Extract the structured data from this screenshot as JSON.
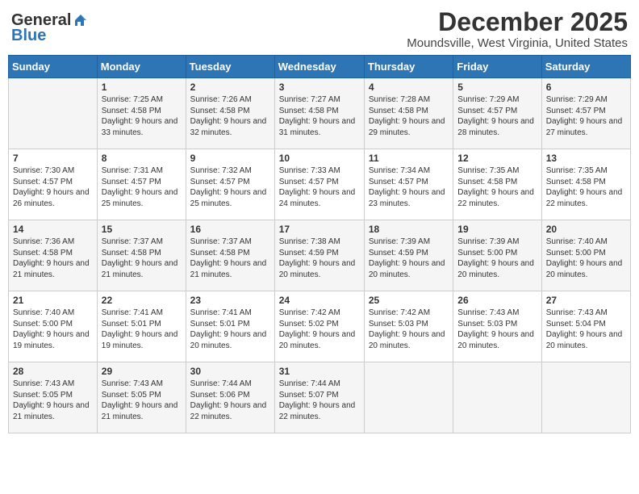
{
  "header": {
    "logo_general": "General",
    "logo_blue": "Blue",
    "month_title": "December 2025",
    "location": "Moundsville, West Virginia, United States"
  },
  "days_of_week": [
    "Sunday",
    "Monday",
    "Tuesday",
    "Wednesday",
    "Thursday",
    "Friday",
    "Saturday"
  ],
  "weeks": [
    [
      {
        "day": "",
        "sunrise": "",
        "sunset": "",
        "daylight": ""
      },
      {
        "day": "1",
        "sunrise": "Sunrise: 7:25 AM",
        "sunset": "Sunset: 4:58 PM",
        "daylight": "Daylight: 9 hours and 33 minutes."
      },
      {
        "day": "2",
        "sunrise": "Sunrise: 7:26 AM",
        "sunset": "Sunset: 4:58 PM",
        "daylight": "Daylight: 9 hours and 32 minutes."
      },
      {
        "day": "3",
        "sunrise": "Sunrise: 7:27 AM",
        "sunset": "Sunset: 4:58 PM",
        "daylight": "Daylight: 9 hours and 31 minutes."
      },
      {
        "day": "4",
        "sunrise": "Sunrise: 7:28 AM",
        "sunset": "Sunset: 4:58 PM",
        "daylight": "Daylight: 9 hours and 29 minutes."
      },
      {
        "day": "5",
        "sunrise": "Sunrise: 7:29 AM",
        "sunset": "Sunset: 4:57 PM",
        "daylight": "Daylight: 9 hours and 28 minutes."
      },
      {
        "day": "6",
        "sunrise": "Sunrise: 7:29 AM",
        "sunset": "Sunset: 4:57 PM",
        "daylight": "Daylight: 9 hours and 27 minutes."
      }
    ],
    [
      {
        "day": "7",
        "sunrise": "Sunrise: 7:30 AM",
        "sunset": "Sunset: 4:57 PM",
        "daylight": "Daylight: 9 hours and 26 minutes."
      },
      {
        "day": "8",
        "sunrise": "Sunrise: 7:31 AM",
        "sunset": "Sunset: 4:57 PM",
        "daylight": "Daylight: 9 hours and 25 minutes."
      },
      {
        "day": "9",
        "sunrise": "Sunrise: 7:32 AM",
        "sunset": "Sunset: 4:57 PM",
        "daylight": "Daylight: 9 hours and 25 minutes."
      },
      {
        "day": "10",
        "sunrise": "Sunrise: 7:33 AM",
        "sunset": "Sunset: 4:57 PM",
        "daylight": "Daylight: 9 hours and 24 minutes."
      },
      {
        "day": "11",
        "sunrise": "Sunrise: 7:34 AM",
        "sunset": "Sunset: 4:57 PM",
        "daylight": "Daylight: 9 hours and 23 minutes."
      },
      {
        "day": "12",
        "sunrise": "Sunrise: 7:35 AM",
        "sunset": "Sunset: 4:58 PM",
        "daylight": "Daylight: 9 hours and 22 minutes."
      },
      {
        "day": "13",
        "sunrise": "Sunrise: 7:35 AM",
        "sunset": "Sunset: 4:58 PM",
        "daylight": "Daylight: 9 hours and 22 minutes."
      }
    ],
    [
      {
        "day": "14",
        "sunrise": "Sunrise: 7:36 AM",
        "sunset": "Sunset: 4:58 PM",
        "daylight": "Daylight: 9 hours and 21 minutes."
      },
      {
        "day": "15",
        "sunrise": "Sunrise: 7:37 AM",
        "sunset": "Sunset: 4:58 PM",
        "daylight": "Daylight: 9 hours and 21 minutes."
      },
      {
        "day": "16",
        "sunrise": "Sunrise: 7:37 AM",
        "sunset": "Sunset: 4:58 PM",
        "daylight": "Daylight: 9 hours and 21 minutes."
      },
      {
        "day": "17",
        "sunrise": "Sunrise: 7:38 AM",
        "sunset": "Sunset: 4:59 PM",
        "daylight": "Daylight: 9 hours and 20 minutes."
      },
      {
        "day": "18",
        "sunrise": "Sunrise: 7:39 AM",
        "sunset": "Sunset: 4:59 PM",
        "daylight": "Daylight: 9 hours and 20 minutes."
      },
      {
        "day": "19",
        "sunrise": "Sunrise: 7:39 AM",
        "sunset": "Sunset: 5:00 PM",
        "daylight": "Daylight: 9 hours and 20 minutes."
      },
      {
        "day": "20",
        "sunrise": "Sunrise: 7:40 AM",
        "sunset": "Sunset: 5:00 PM",
        "daylight": "Daylight: 9 hours and 20 minutes."
      }
    ],
    [
      {
        "day": "21",
        "sunrise": "Sunrise: 7:40 AM",
        "sunset": "Sunset: 5:00 PM",
        "daylight": "Daylight: 9 hours and 19 minutes."
      },
      {
        "day": "22",
        "sunrise": "Sunrise: 7:41 AM",
        "sunset": "Sunset: 5:01 PM",
        "daylight": "Daylight: 9 hours and 19 minutes."
      },
      {
        "day": "23",
        "sunrise": "Sunrise: 7:41 AM",
        "sunset": "Sunset: 5:01 PM",
        "daylight": "Daylight: 9 hours and 20 minutes."
      },
      {
        "day": "24",
        "sunrise": "Sunrise: 7:42 AM",
        "sunset": "Sunset: 5:02 PM",
        "daylight": "Daylight: 9 hours and 20 minutes."
      },
      {
        "day": "25",
        "sunrise": "Sunrise: 7:42 AM",
        "sunset": "Sunset: 5:03 PM",
        "daylight": "Daylight: 9 hours and 20 minutes."
      },
      {
        "day": "26",
        "sunrise": "Sunrise: 7:43 AM",
        "sunset": "Sunset: 5:03 PM",
        "daylight": "Daylight: 9 hours and 20 minutes."
      },
      {
        "day": "27",
        "sunrise": "Sunrise: 7:43 AM",
        "sunset": "Sunset: 5:04 PM",
        "daylight": "Daylight: 9 hours and 20 minutes."
      }
    ],
    [
      {
        "day": "28",
        "sunrise": "Sunrise: 7:43 AM",
        "sunset": "Sunset: 5:05 PM",
        "daylight": "Daylight: 9 hours and 21 minutes."
      },
      {
        "day": "29",
        "sunrise": "Sunrise: 7:43 AM",
        "sunset": "Sunset: 5:05 PM",
        "daylight": "Daylight: 9 hours and 21 minutes."
      },
      {
        "day": "30",
        "sunrise": "Sunrise: 7:44 AM",
        "sunset": "Sunset: 5:06 PM",
        "daylight": "Daylight: 9 hours and 22 minutes."
      },
      {
        "day": "31",
        "sunrise": "Sunrise: 7:44 AM",
        "sunset": "Sunset: 5:07 PM",
        "daylight": "Daylight: 9 hours and 22 minutes."
      },
      {
        "day": "",
        "sunrise": "",
        "sunset": "",
        "daylight": ""
      },
      {
        "day": "",
        "sunrise": "",
        "sunset": "",
        "daylight": ""
      },
      {
        "day": "",
        "sunrise": "",
        "sunset": "",
        "daylight": ""
      }
    ]
  ]
}
